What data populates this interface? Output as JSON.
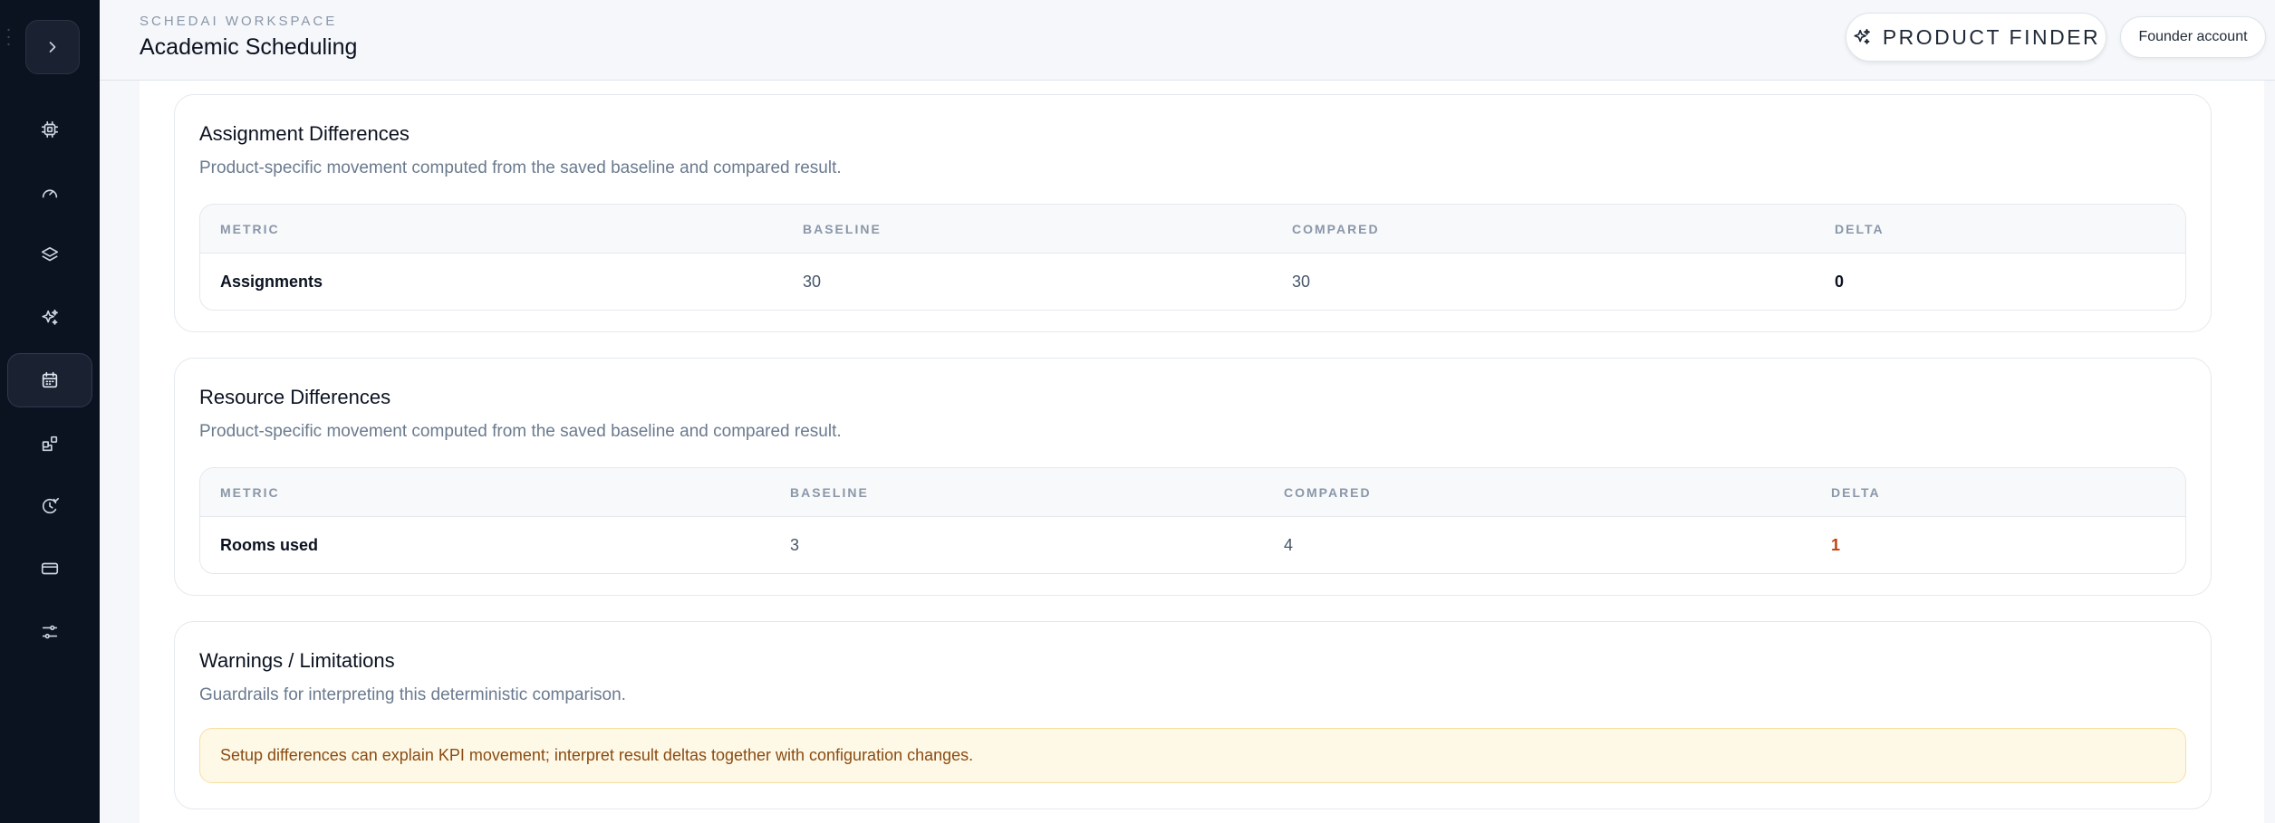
{
  "header": {
    "eyebrow": "SCHEDAI WORKSPACE",
    "title": "Academic Scheduling",
    "product_finder_label": "PRODUCT FINDER",
    "account_label": "Founder account"
  },
  "sidebar": {
    "items": [
      {
        "icon": "cpu-icon"
      },
      {
        "icon": "gauge-icon"
      },
      {
        "icon": "layers-icon"
      },
      {
        "icon": "sparkles-icon"
      },
      {
        "icon": "calendar-icon",
        "active": true
      },
      {
        "icon": "blocks-icon"
      },
      {
        "icon": "bot-icon"
      },
      {
        "icon": "credit-card-icon"
      },
      {
        "icon": "sliders-icon"
      }
    ]
  },
  "assignment": {
    "title": "Assignment Differences",
    "subtitle": "Product-specific movement computed from the saved baseline and compared result.",
    "columns": [
      "METRIC",
      "BASELINE",
      "COMPARED",
      "DELTA"
    ],
    "row": {
      "metric": "Assignments",
      "baseline": "30",
      "compared": "30",
      "delta": "0"
    }
  },
  "resource": {
    "title": "Resource Differences",
    "subtitle": "Product-specific movement computed from the saved baseline and compared result.",
    "columns": [
      "METRIC",
      "BASELINE",
      "COMPARED",
      "DELTA"
    ],
    "row": {
      "metric": "Rooms used",
      "baseline": "3",
      "compared": "4",
      "delta": "1"
    }
  },
  "warnings": {
    "title": "Warnings / Limitations",
    "subtitle": "Guardrails for interpreting this deterministic comparison.",
    "message": "Setup differences can explain KPI movement; interpret result deltas together with configuration changes."
  },
  "colors": {
    "sidebar_bg": "#0b1220",
    "delta_increase": "#c2410c",
    "warning_bg": "#fef9e7",
    "warning_text": "#8a4b12"
  }
}
